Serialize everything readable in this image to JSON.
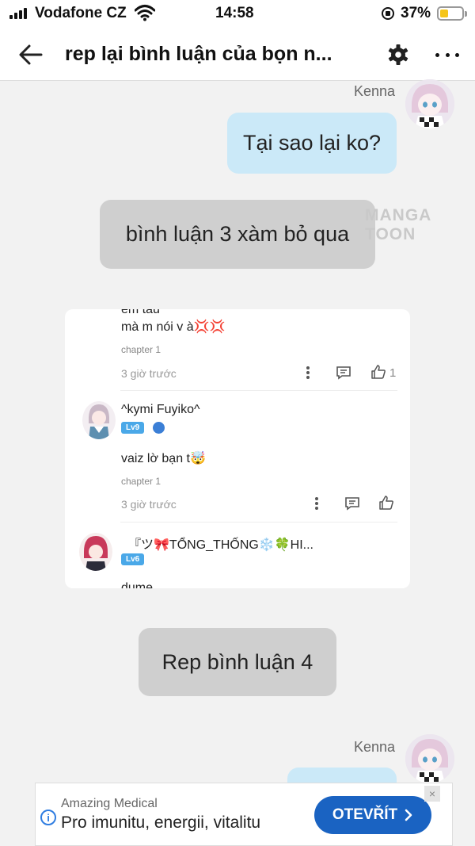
{
  "status_bar": {
    "carrier": "Vodafone CZ",
    "time": "14:58",
    "battery_percent": "37%",
    "battery_level": 0.37,
    "battery_color": "#f5c518"
  },
  "nav": {
    "title": "rep lại bình luận của bọn n...",
    "back_icon": "arrow-left-icon",
    "settings_icon": "gear-icon",
    "more_icon": "more-horizontal-icon"
  },
  "chat": {
    "sender_1": "Kenna",
    "bubble_1": "Tại sao lại ko?",
    "bubble_2": "bình luận 3 xàm bỏ qua",
    "watermark": "MANGA TOON",
    "bubble_3": "Rep bình luận 4",
    "sender_2": "Kenna",
    "colors": {
      "outgoing_bubble": "#cbe9f8",
      "gray_bubble": "#cfcfcf"
    }
  },
  "card": {
    "top_cut_text": "em tau",
    "comment_1": {
      "text": "mà m nói v à💢💢",
      "chapter": "chapter 1",
      "time": "3 giờ trước",
      "likes": "1"
    },
    "comment_2": {
      "username": "^kymi Fuyiko^",
      "level": "Lv9",
      "text": "vaiz lờ bạn t🤯",
      "chapter": "chapter 1",
      "time": "3 giờ trước"
    },
    "comment_3": {
      "username": "『ツ🎀TỔNG_THỐNG❄️🍀HI...",
      "level": "Lv6",
      "text": "dume"
    }
  },
  "ad": {
    "brand": "Amazing Medical",
    "line": "Pro imunitu, energii, vitalitu",
    "button": "OTEVŘÍT",
    "info_glyph": "i",
    "close_glyph": "×"
  }
}
